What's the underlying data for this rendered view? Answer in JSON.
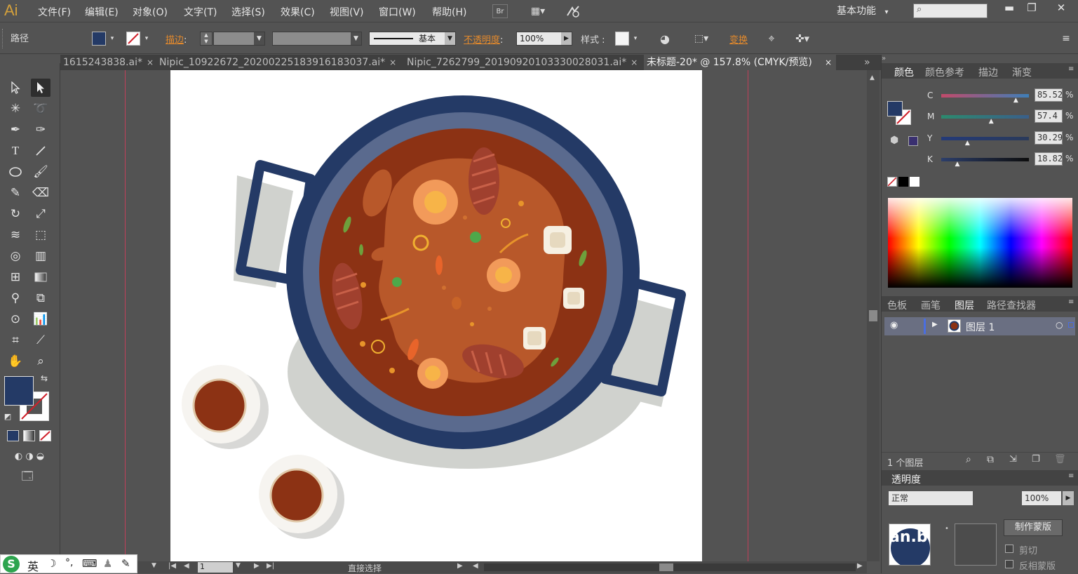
{
  "app": {
    "logo": "Ai"
  },
  "menu": [
    "文件(F)",
    "编辑(E)",
    "对象(O)",
    "文字(T)",
    "选择(S)",
    "效果(C)",
    "视图(V)",
    "窗口(W)",
    "帮助(H)"
  ],
  "workspace": {
    "label": "基本功能",
    "arrow": "▾"
  },
  "window_buttons": [
    "▬",
    "❐",
    "✕"
  ],
  "control": {
    "object_type": "路径",
    "stroke_link": "描边",
    "stroke_colon": ":",
    "stroke_style": "基本",
    "opacity_link": "不透明度",
    "opacity_colon": ":",
    "opacity_value": "100%",
    "style_label": "样式 :",
    "transform_link": "变换"
  },
  "tabs": [
    {
      "label": "1615243838.ai*",
      "close": "×"
    },
    {
      "label": "Nipic_10922672_20200225183916183037.ai*",
      "close": "×"
    },
    {
      "label": "Nipic_7262799_20190920103330028031.ai*",
      "close": "×"
    },
    {
      "label": "未标题-20* @ 157.8% (CMYK/预览)",
      "close": "×"
    }
  ],
  "tab_overflow": "»",
  "color_panel": {
    "tabs": [
      "颜色",
      "颜色参考",
      "描边",
      "渐变"
    ],
    "channels": [
      {
        "name": "C",
        "value": "85.52",
        "pct": "%",
        "level": 0.855,
        "colors": [
          "#c24a6a",
          "#3e7fb8"
        ]
      },
      {
        "name": "M",
        "value": "57.4",
        "pct": "%",
        "level": 0.574,
        "colors": [
          "#2c8a6e",
          "#3a5f8a"
        ]
      },
      {
        "name": "Y",
        "value": "30.29",
        "pct": "%",
        "level": 0.303,
        "colors": [
          "#243a78",
          "#2a3a5a"
        ]
      },
      {
        "name": "K",
        "value": "18.82",
        "pct": "%",
        "level": 0.188,
        "colors": [
          "#2c3e6a",
          "#0d0d0d"
        ]
      }
    ],
    "fill_color": "#243a66"
  },
  "layers_panel": {
    "tabs": [
      "色板",
      "画笔",
      "图层",
      "路径查找器"
    ],
    "layer_name": "图层 1",
    "count": "1 个图层"
  },
  "transparency_panel": {
    "title": "透明度",
    "opacity": "100%",
    "mode_prefix": "正常",
    "make_mask": "制作蒙版",
    "clip": "剪切",
    "invert": "反相蒙版",
    "thumb_text": "an.b"
  },
  "statusbar": {
    "page": "1",
    "mode": "直接选择"
  },
  "ime": {
    "brand": "S",
    "lang": "英",
    "items": [
      "☽",
      "°,",
      "⌨",
      "♟",
      "✎"
    ]
  }
}
